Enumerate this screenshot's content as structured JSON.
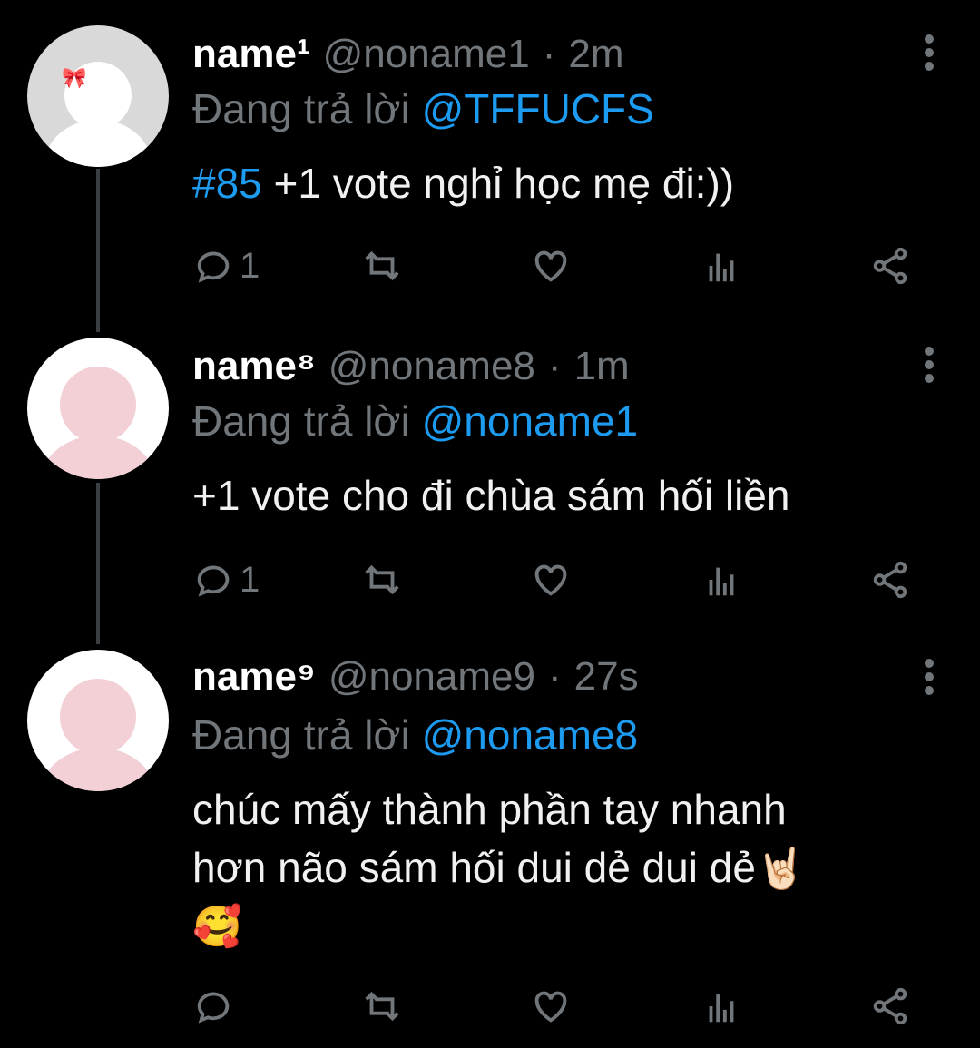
{
  "colors": {
    "background": "#000000",
    "accent": "#1d9bf0",
    "muted": "#71767b",
    "avatar_pink": "#f2d0d6"
  },
  "icons": {
    "more": "more-vertical-icon",
    "reply": "reply-bubble-icon",
    "retweet": "retweet-icon",
    "like": "heart-icon",
    "views": "analytics-icon",
    "share": "share-icon",
    "bow": "bow"
  },
  "tweets": [
    {
      "name": "name¹",
      "handle": "@noname1",
      "separator": "·",
      "time": "2m",
      "reply_label": "Đang trả lời",
      "reply_to": "@TFFUCFS",
      "hashtag": "#85",
      "text_lines": [
        " +1 vote nghỉ học mẹ đi:))"
      ],
      "reply_count": "1"
    },
    {
      "name": "name⁸",
      "handle": "@noname8",
      "separator": "·",
      "time": "1m",
      "reply_label": "Đang trả lời",
      "reply_to": "@noname1",
      "text_lines": [
        "+1 vote cho đi chùa sám hối liền"
      ],
      "reply_count": "1"
    },
    {
      "name": "name⁹",
      "handle": "@noname9",
      "separator": "·",
      "time": "27s",
      "reply_label": "Đang trả lời",
      "reply_to": "@noname8",
      "text_lines": [
        "chúc mấy thành phần tay nhanh",
        "hơn não sám hối dui dẻ dui dẻ"
      ],
      "emoji_1": "🤘🏻",
      "emoji_2": "🥰",
      "reply_count": ""
    }
  ]
}
